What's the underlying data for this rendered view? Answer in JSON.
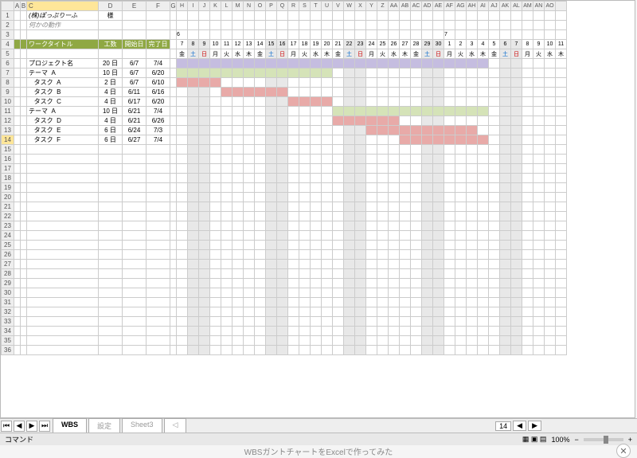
{
  "columns": [
    "A",
    "B",
    "C",
    "D",
    "E",
    "F",
    "G",
    "H",
    "I",
    "J",
    "K",
    "L",
    "M",
    "N",
    "O",
    "P",
    "Q",
    "R",
    "S",
    "T",
    "U",
    "V",
    "W",
    "X",
    "Y",
    "Z",
    "AA",
    "AB",
    "AC",
    "AD",
    "AE",
    "AF",
    "AG",
    "AH",
    "AI",
    "AJ",
    "AK",
    "AL",
    "AM",
    "AN",
    "AO"
  ],
  "selected_col": "C",
  "row_count": 36,
  "selected_row": 14,
  "row1": {
    "company": "(株)ぽっぷりーふ",
    "suffix": "様"
  },
  "row2": {
    "label": "何かの動作"
  },
  "months": {
    "m1": "6",
    "m1_span_start": 8,
    "m2": "7",
    "m2_span_start": 32
  },
  "header": {
    "title": "ワークタイトル",
    "dur": "工数",
    "start": "開始日",
    "end": "完了日"
  },
  "days": [
    {
      "n": "7",
      "w": "金"
    },
    {
      "n": "8",
      "w": "土"
    },
    {
      "n": "9",
      "w": "日"
    },
    {
      "n": "10",
      "w": "月"
    },
    {
      "n": "11",
      "w": "火"
    },
    {
      "n": "12",
      "w": "水"
    },
    {
      "n": "13",
      "w": "木"
    },
    {
      "n": "14",
      "w": "金"
    },
    {
      "n": "15",
      "w": "土"
    },
    {
      "n": "16",
      "w": "日"
    },
    {
      "n": "17",
      "w": "月"
    },
    {
      "n": "18",
      "w": "火"
    },
    {
      "n": "19",
      "w": "水"
    },
    {
      "n": "20",
      "w": "木"
    },
    {
      "n": "21",
      "w": "金"
    },
    {
      "n": "22",
      "w": "土"
    },
    {
      "n": "23",
      "w": "日"
    },
    {
      "n": "24",
      "w": "月"
    },
    {
      "n": "25",
      "w": "火"
    },
    {
      "n": "26",
      "w": "水"
    },
    {
      "n": "27",
      "w": "木"
    },
    {
      "n": "28",
      "w": "金"
    },
    {
      "n": "29",
      "w": "土"
    },
    {
      "n": "30",
      "w": "日"
    },
    {
      "n": "1",
      "w": "月"
    },
    {
      "n": "2",
      "w": "火"
    },
    {
      "n": "3",
      "w": "水"
    },
    {
      "n": "4",
      "w": "木"
    },
    {
      "n": "5",
      "w": "金"
    },
    {
      "n": "6",
      "w": "土"
    },
    {
      "n": "7",
      "w": "日"
    },
    {
      "n": "8",
      "w": "月"
    },
    {
      "n": "9",
      "w": "火"
    },
    {
      "n": "10",
      "w": "水"
    },
    {
      "n": "11",
      "w": "木"
    }
  ],
  "tasks": [
    {
      "r": 6,
      "name": "プロジェクト名",
      "dur": "20 日",
      "s": "6/7",
      "e": "7/4",
      "bar": {
        "from": 0,
        "to": 28,
        "cls": "bar-pur"
      }
    },
    {
      "r": 7,
      "name": "テーマ  A",
      "dur": "10 日",
      "s": "6/7",
      "e": "6/20",
      "bar": {
        "from": 0,
        "to": 14,
        "cls": "bar-grn"
      }
    },
    {
      "r": 8,
      "name": "   タスク  A",
      "dur": "2 日",
      "s": "6/7",
      "e": "6/10",
      "bar": {
        "from": 0,
        "to": 4,
        "cls": "bar-red"
      }
    },
    {
      "r": 9,
      "name": "   タスク  B",
      "dur": "4 日",
      "s": "6/11",
      "e": "6/16",
      "bar": {
        "from": 4,
        "to": 10,
        "cls": "bar-red"
      }
    },
    {
      "r": 9.5,
      "name": "   タスク  C",
      "dur": "4 日",
      "s": "6/17",
      "e": "6/20",
      "bar": {
        "from": 10,
        "to": 14,
        "cls": "bar-red"
      }
    },
    {
      "r": 10,
      "name": "テーマ  A",
      "dur": "10 日",
      "s": "6/21",
      "e": "7/4",
      "bar": {
        "from": 14,
        "to": 28,
        "cls": "bar-grn"
      }
    },
    {
      "r": 11,
      "name": "   タスク  D",
      "dur": "4 日",
      "s": "6/21",
      "e": "6/26",
      "bar": {
        "from": 14,
        "to": 20,
        "cls": "bar-red"
      }
    },
    {
      "r": 12,
      "name": "   タスク  E",
      "dur": "6 日",
      "s": "6/24",
      "e": "7/3",
      "bar": {
        "from": 17,
        "to": 27,
        "cls": "bar-red"
      }
    },
    {
      "r": 13,
      "name": "   タスク  F",
      "dur": "6 日",
      "s": "6/27",
      "e": "7/4",
      "bar": {
        "from": 20,
        "to": 28,
        "cls": "bar-red"
      }
    }
  ],
  "tabs": {
    "items": [
      "WBS",
      "設定",
      "Sheet3"
    ],
    "active": 0,
    "end": "◁"
  },
  "status": {
    "left": "コマンド",
    "page": "14",
    "zoom": "100%"
  },
  "caption": "WBSガントチャートをExcelで作ってみた",
  "icons": {
    "first": "⏮",
    "prev": "◀",
    "next": "▶",
    "last": "⏭",
    "close": "✕",
    "minus": "−",
    "plus": "+"
  }
}
